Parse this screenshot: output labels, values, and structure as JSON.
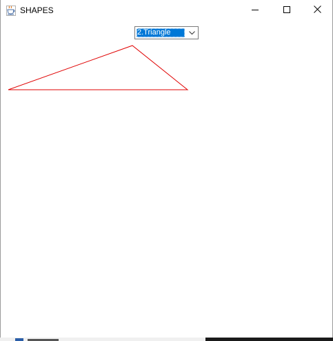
{
  "window": {
    "title": "SHAPES"
  },
  "icons": {
    "app": "java-coffee-cup-icon",
    "minimize": "minimize-icon",
    "maximize": "maximize-icon",
    "close": "close-icon",
    "dropdown": "chevron-down-icon"
  },
  "shape_selector": {
    "selected": "2.Triangle"
  },
  "drawing": {
    "shape": "triangle",
    "stroke_color": "#e00000"
  },
  "colors": {
    "selection": "#0078d7",
    "background": "#ffffff"
  }
}
